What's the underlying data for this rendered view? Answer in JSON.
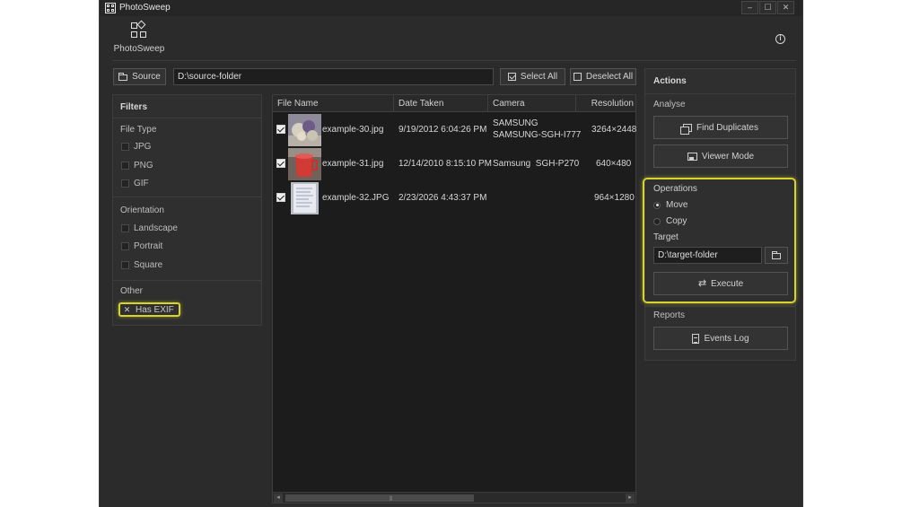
{
  "app": {
    "title": "PhotoSweep",
    "logo_label": "PhotoSweep",
    "window_controls": [
      "minimize",
      "maximize",
      "close"
    ]
  },
  "toolbar": {
    "source_label": "Source",
    "source_path": "D:\\source-folder",
    "select_all_label": "Select All",
    "deselect_all_label": "Deselect All"
  },
  "filters": {
    "title": "Filters",
    "file_type": {
      "label": "File Type",
      "items": [
        {
          "label": "JPG",
          "checked": false
        },
        {
          "label": "PNG",
          "checked": false
        },
        {
          "label": "GIF",
          "checked": false
        }
      ]
    },
    "orientation": {
      "label": "Orientation",
      "items": [
        {
          "label": "Landscape",
          "checked": false
        },
        {
          "label": "Portrait",
          "checked": false
        },
        {
          "label": "Square",
          "checked": false
        }
      ]
    },
    "other": {
      "label": "Other",
      "items": [
        {
          "label": "Has EXIF",
          "state": "excluded"
        }
      ]
    }
  },
  "table": {
    "columns": [
      "File Name",
      "Date Taken",
      "Camera",
      "Resolution"
    ],
    "rows": [
      {
        "checked": true,
        "file_name": "example-30.jpg",
        "date_taken": "9/19/2012 6:04:26 PM",
        "camera": [
          "SAMSUNG",
          "SAMSUNG-SGH-I777"
        ],
        "resolution": "3264×2448"
      },
      {
        "checked": true,
        "file_name": "example-31.jpg",
        "date_taken": "12/14/2010 8:15:10 PM",
        "camera": [
          "Samsung  SGH-P270"
        ],
        "resolution": "640×480"
      },
      {
        "checked": true,
        "file_name": "example-32.JPG",
        "date_taken": "2/23/2026 4:43:37 PM",
        "camera": [],
        "resolution": "964×1280"
      }
    ]
  },
  "actions": {
    "title": "Actions",
    "analyse_label": "Analyse",
    "find_duplicates_label": "Find Duplicates",
    "viewer_mode_label": "Viewer Mode",
    "operations_label": "Operations",
    "move_label": "Move",
    "copy_label": "Copy",
    "selected_operation": "Move",
    "target_label": "Target",
    "target_path": "D:\\target-folder",
    "execute_label": "Execute",
    "reports_label": "Reports",
    "events_log_label": "Events Log"
  },
  "colors": {
    "highlight": "#d6d42d",
    "background": "#2b2b2b",
    "table_background": "#1c1c1c"
  }
}
